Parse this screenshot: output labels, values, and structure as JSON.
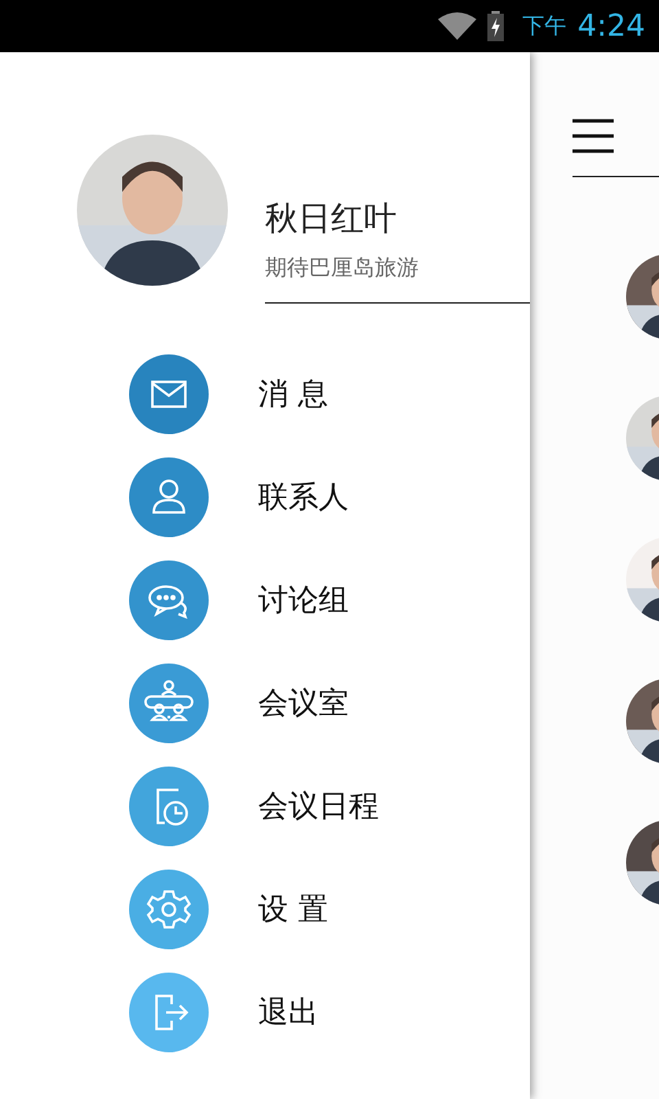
{
  "status_bar": {
    "period": "下午",
    "time": "4:24"
  },
  "profile": {
    "name": "秋日红叶",
    "status": "期待巴厘岛旅游"
  },
  "menu": [
    {
      "label": "消 息",
      "kind": "mail"
    },
    {
      "label": "联系人",
      "kind": "contact"
    },
    {
      "label": "讨论组",
      "kind": "chat"
    },
    {
      "label": "会议室",
      "kind": "meeting"
    },
    {
      "label": "会议日程",
      "kind": "schedule"
    },
    {
      "label": "设 置",
      "kind": "settings"
    },
    {
      "label": "退出",
      "kind": "exit"
    }
  ]
}
